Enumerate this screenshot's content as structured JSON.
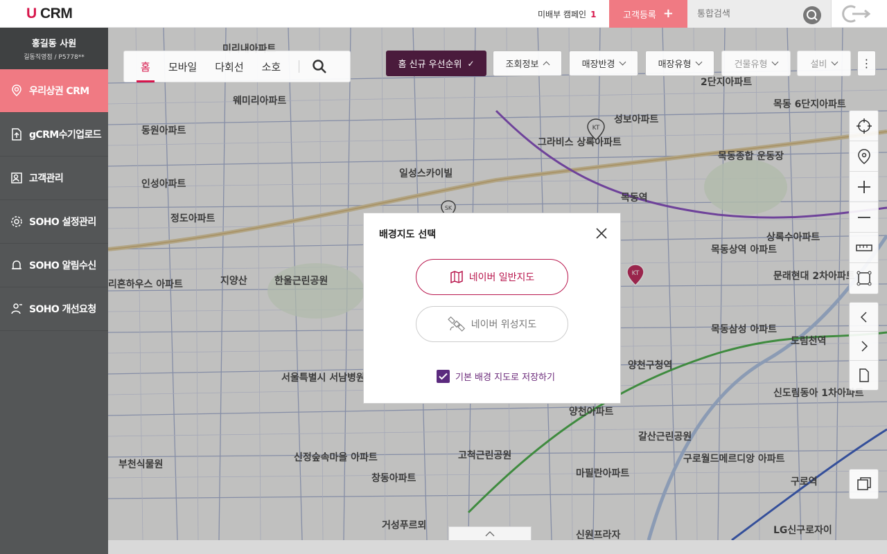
{
  "header": {
    "logo_u": "U",
    "logo_crm": "CRM",
    "campaign_label": "미배부 캠페인",
    "campaign_count": "1",
    "register_label": "고객등록",
    "search_placeholder": "통합검색"
  },
  "sidebar": {
    "user_name": "홍길동 사원",
    "user_sub": "길동직영점 / P5778**",
    "items": [
      {
        "label": "우리상권 CRM",
        "icon": "location-pin-icon",
        "active": true
      },
      {
        "label": "gCRM수기업로드",
        "icon": "upload-file-icon",
        "active": false
      },
      {
        "label": "고객관리",
        "icon": "customer-manage-icon",
        "active": false
      },
      {
        "label": "SOHO 설정관리",
        "icon": "settings-gear-icon",
        "active": false
      },
      {
        "label": "SOHO 알림수신",
        "icon": "notification-icon",
        "active": false
      },
      {
        "label": "SOHO 개선요청",
        "icon": "request-icon",
        "active": false
      }
    ]
  },
  "map": {
    "tabs": [
      "홈",
      "모바일",
      "다회선",
      "소호"
    ],
    "active_tab": "홈",
    "filters": {
      "priority": "홈 신규 우선순위",
      "query_info": "조회정보",
      "store_radius": "매장반경",
      "store_type": "매장유형",
      "building_type": "건물유형",
      "equipment": "설비"
    },
    "labels": [
      "미리내아파트",
      "웨미리아파트",
      "동원아파트",
      "인성아파트",
      "정도아파트",
      "리혼하우스 아파트",
      "지양산",
      "한울근린공원",
      "서울특별시 서남병원",
      "신정숲속마을 아파트",
      "창동아파트",
      "부천식물원",
      "일성스카이빌",
      "그라비스 상록아파트",
      "목동역",
      "목동종합 운동장",
      "성보아파트",
      "목동 6단지아파트",
      "2단지아파트",
      "양천구청역",
      "양천아파트",
      "갈산근린공원",
      "고척근린공원",
      "마필란아파트",
      "구로월드메르디앙 아파트",
      "신도림동아 1차아파트",
      "구로역",
      "도림천역",
      "목동삼성 아파트",
      "목동상역 아파트",
      "상록수아파트",
      "문래현대 2차아파트",
      "신원프라자",
      "거성푸르뫼",
      "LG신구로자이"
    ]
  },
  "modal": {
    "title": "배경지도 선택",
    "option_normal": "네이버 일반지도",
    "option_satellite": "네이버 위성지도",
    "save_default_label": "기본 배경 지도로 저장하기",
    "save_default_checked": true,
    "selected_option": "네이버 일반지도"
  },
  "colors": {
    "brand": "#d7164b",
    "sidebar_bg": "#545657",
    "active_nav": "#f07a83",
    "modal_accent": "#b8154c",
    "filter_dark": "#4a1b3c"
  }
}
